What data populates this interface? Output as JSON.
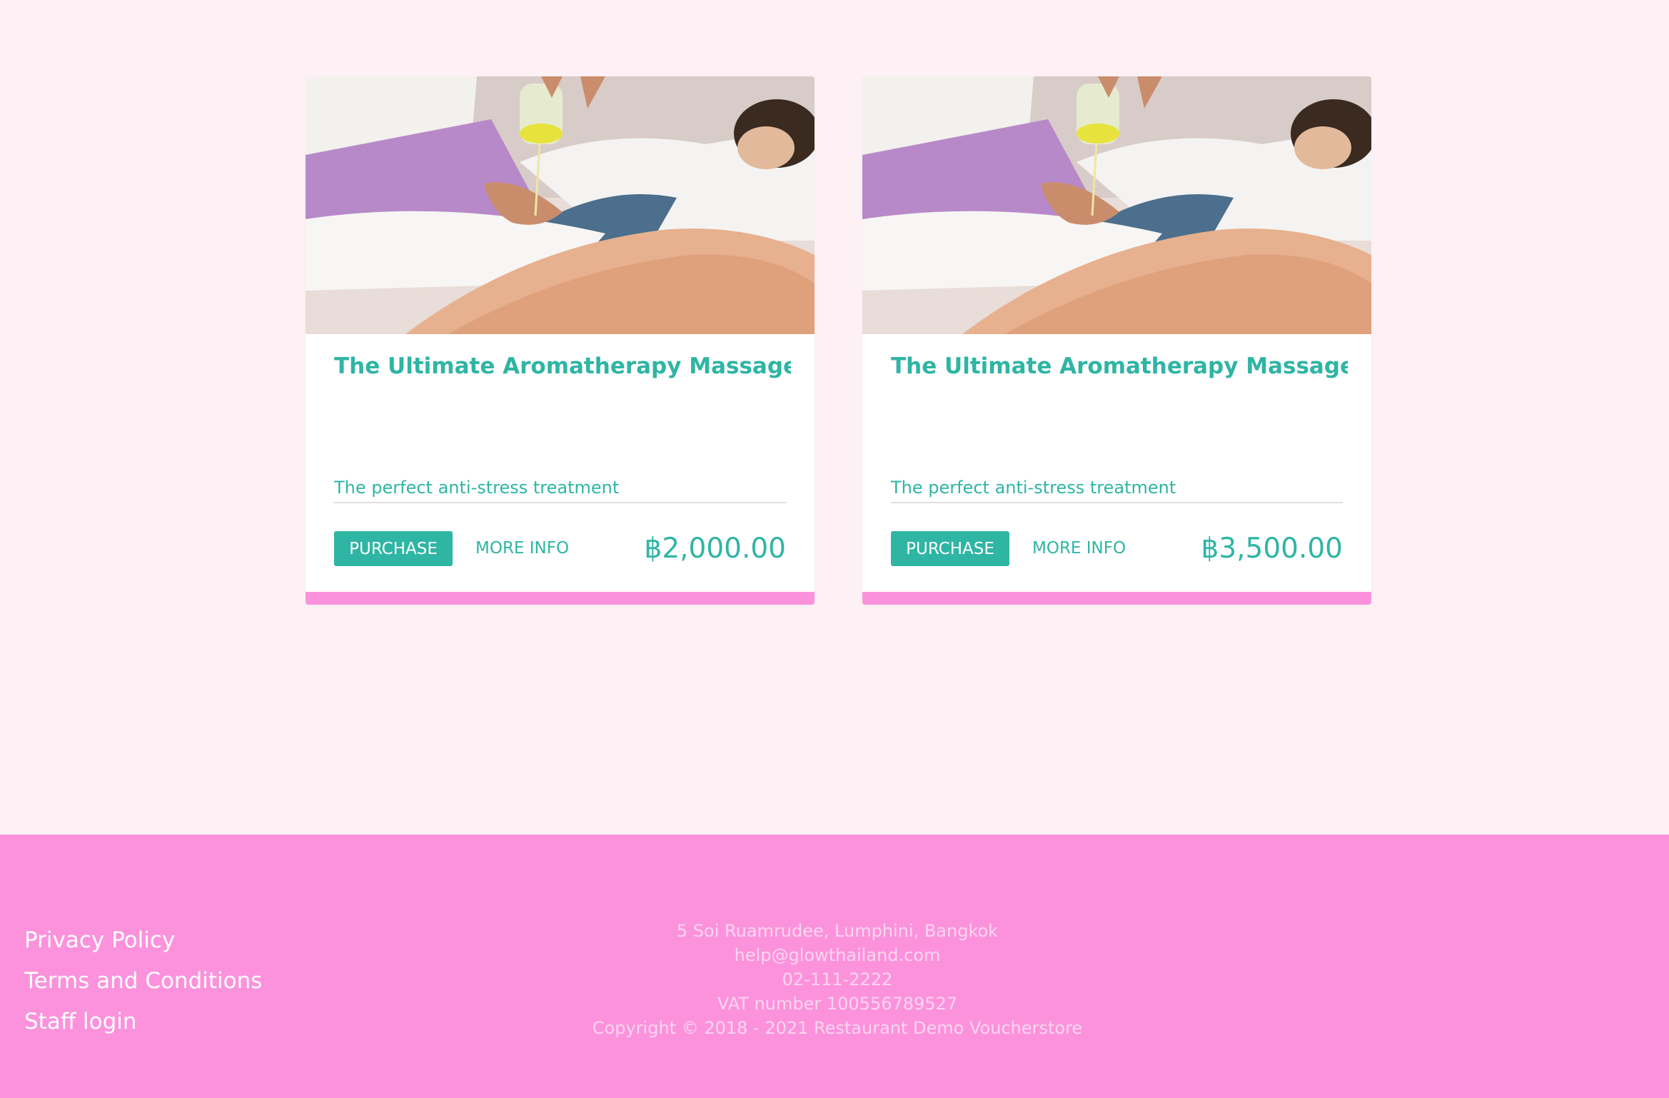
{
  "products": [
    {
      "title": "The Ultimate Aromatherapy Massage",
      "description": "The perfect anti-stress treatment",
      "purchase_label": "PURCHASE",
      "more_info_label": "MORE INFO",
      "price": "฿2,000.00"
    },
    {
      "title": "The Ultimate Aromatherapy Massage (...",
      "description": "The perfect anti-stress treatment",
      "purchase_label": "PURCHASE",
      "more_info_label": "MORE INFO",
      "price": "฿3,500.00"
    }
  ],
  "footer": {
    "links": [
      "Privacy Policy",
      "Terms and Conditions",
      "Staff login"
    ],
    "address": "5 Soi Ruamrudee, Lumphini, Bangkok",
    "email": "help@glowthailand.com",
    "phone": "02-111-2222",
    "vat": "VAT number 100556789527",
    "copyright": "Copyright © 2018 - 2021 Restaurant Demo Voucherstore"
  },
  "colors": {
    "accent": "#2fb5a4",
    "pink": "#fc92dc",
    "page_background": "#fdf1f5"
  },
  "icons": {
    "product_image": "aromatherapy-massage-photo"
  }
}
